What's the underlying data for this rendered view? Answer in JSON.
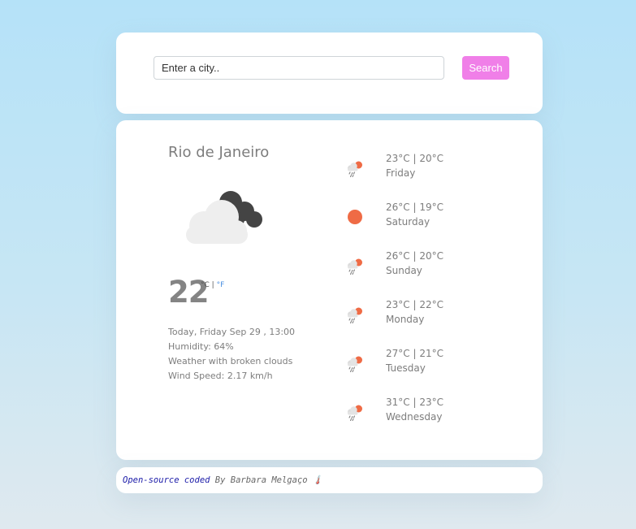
{
  "search": {
    "placeholder": "Enter a city..",
    "button_label": "Search"
  },
  "current": {
    "city": "Rio de Janeiro",
    "icon": "broken-clouds-icon",
    "temperature": "22",
    "unit_c": "°C",
    "unit_separator": "|",
    "unit_f": "°F",
    "date": "Today, Friday Sep 29 , 13:00",
    "humidity": "Humidity: 64%",
    "description": "Weather with broken clouds",
    "wind": "Wind Speed: 2.17 km/h"
  },
  "forecast": [
    {
      "temp": "23°C | 20°C",
      "day": "Friday",
      "icon": "rain-sun-icon"
    },
    {
      "temp": "26°C | 19°C",
      "day": "Saturday",
      "icon": "sun-icon"
    },
    {
      "temp": "26°C | 20°C",
      "day": "Sunday",
      "icon": "rain-sun-icon"
    },
    {
      "temp": "23°C | 22°C",
      "day": "Monday",
      "icon": "rain-sun-icon"
    },
    {
      "temp": "27°C | 21°C",
      "day": "Tuesday",
      "icon": "rain-sun-icon"
    },
    {
      "temp": "31°C | 23°C",
      "day": "Wednesday",
      "icon": "rain-sun-icon"
    }
  ],
  "footer": {
    "link_text": "Open-source coded",
    "author_text": "By Barbara Melgaço",
    "emoji": "🌡️"
  },
  "colors": {
    "accent": "#f07fe8",
    "sun": "#ef6b45",
    "link": "#1a1aa8"
  }
}
